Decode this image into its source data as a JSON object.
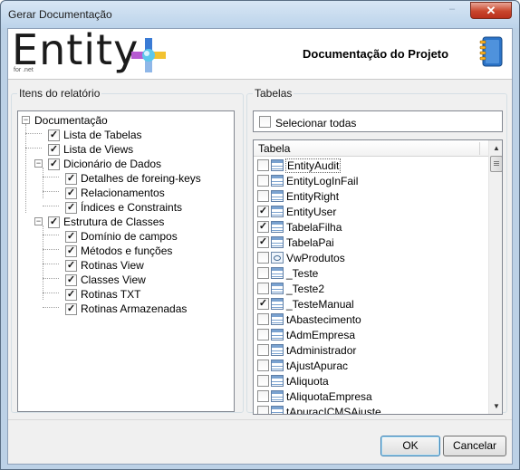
{
  "window": {
    "title": "Gerar Documentação",
    "close_glyph": "✕",
    "minimize_glyph": "–"
  },
  "header": {
    "logo_text": "Entity",
    "logo_sub": "for .net",
    "title": "Documentação do Projeto",
    "book_icon": "notebook-icon"
  },
  "left_group": {
    "legend": "Itens do relatório",
    "tree": [
      {
        "label": "Documentação",
        "checkbox": false,
        "expander": "−",
        "level": 0
      },
      {
        "label": "Lista de Tabelas",
        "checked": true,
        "level": 1
      },
      {
        "label": "Lista de Views",
        "checked": true,
        "level": 1
      },
      {
        "label": "Dicionário de Dados",
        "checked": true,
        "expander": "−",
        "level": 1
      },
      {
        "label": "Detalhes de foreing-keys",
        "checked": true,
        "level": 2
      },
      {
        "label": "Relacionamentos",
        "checked": true,
        "level": 2
      },
      {
        "label": "Índices e Constraints",
        "checked": true,
        "level": 2
      },
      {
        "label": "Estrutura de Classes",
        "checked": true,
        "expander": "−",
        "level": 1
      },
      {
        "label": "Domínio de campos",
        "checked": true,
        "level": 2
      },
      {
        "label": "Métodos e funções",
        "checked": true,
        "level": 2
      },
      {
        "label": "Rotinas View",
        "checked": true,
        "level": 2
      },
      {
        "label": "Classes View",
        "checked": true,
        "level": 2
      },
      {
        "label": "Rotinas TXT",
        "checked": true,
        "level": 2
      },
      {
        "label": "Rotinas Armazenadas",
        "checked": true,
        "level": 2
      }
    ]
  },
  "right_group": {
    "legend": "Tabelas",
    "select_all_label": "Selecionar todas",
    "select_all_checked": false,
    "column_header": "Tabela",
    "rows": [
      {
        "name": "EntityAudit",
        "checked": false,
        "kind": "table",
        "selected": true
      },
      {
        "name": "EntityLogInFail",
        "checked": false,
        "kind": "table"
      },
      {
        "name": "EntityRight",
        "checked": false,
        "kind": "table"
      },
      {
        "name": "EntityUser",
        "checked": true,
        "kind": "table"
      },
      {
        "name": "TabelaFilha",
        "checked": true,
        "kind": "table"
      },
      {
        "name": "TabelaPai",
        "checked": true,
        "kind": "table"
      },
      {
        "name": "VwProdutos",
        "checked": false,
        "kind": "view"
      },
      {
        "name": "_Teste",
        "checked": false,
        "kind": "table"
      },
      {
        "name": "_Teste2",
        "checked": false,
        "kind": "table"
      },
      {
        "name": "_TesteManual",
        "checked": true,
        "kind": "table"
      },
      {
        "name": "tAbastecimento",
        "checked": false,
        "kind": "table"
      },
      {
        "name": "tAdmEmpresa",
        "checked": false,
        "kind": "table"
      },
      {
        "name": "tAdministrador",
        "checked": false,
        "kind": "table"
      },
      {
        "name": "tAjustApurac",
        "checked": false,
        "kind": "table"
      },
      {
        "name": "tAliquota",
        "checked": false,
        "kind": "table"
      },
      {
        "name": "tAliquotaEmpresa",
        "checked": false,
        "kind": "table"
      },
      {
        "name": "tApuracICMSAjuste",
        "checked": false,
        "kind": "table"
      }
    ],
    "scroll_up_glyph": "▲",
    "scroll_down_glyph": "▼"
  },
  "footer": {
    "ok_label": "OK",
    "cancel_label": "Cancelar"
  }
}
